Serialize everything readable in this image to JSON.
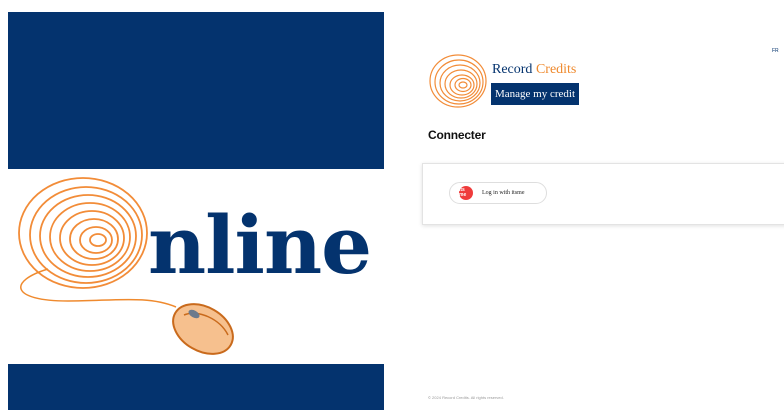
{
  "hero": {
    "headline": "nline",
    "colors": {
      "navy": "#04336e",
      "orange": "#ef8a2e",
      "light_orange": "#f6c08e"
    },
    "icons": [
      "fingerprint-icon",
      "computer-mouse-icon"
    ]
  },
  "header": {
    "language": "FR",
    "brand": {
      "name_part1": "Record",
      "name_part2": "Credits"
    },
    "manage_button": "Manage my credit"
  },
  "page": {
    "title": "Connecter"
  },
  "login": {
    "itsme_icon_text": "its me",
    "itsme_label": "Log in with itsme"
  },
  "footer": {
    "copyright": "© 2024 Record Credits. All rights reserved."
  }
}
